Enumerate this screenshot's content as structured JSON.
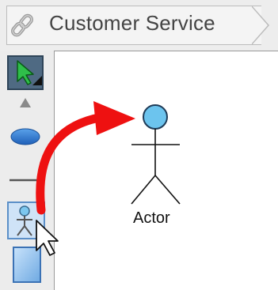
{
  "breadcrumb": {
    "icon": "link-icon",
    "label": "Customer Service"
  },
  "toolbar": {
    "tools": [
      {
        "name": "select-tool",
        "icon": "selection-arrow-icon",
        "selected": true
      },
      {
        "name": "collapse-tool",
        "icon": "triangle-up-icon"
      },
      {
        "name": "use-case-tool",
        "icon": "ellipse-icon"
      },
      {
        "name": "association-tool",
        "icon": "line-icon"
      },
      {
        "name": "actor-tool",
        "icon": "actor-icon",
        "hovered": true
      },
      {
        "name": "system-tool",
        "icon": "rectangle-icon"
      }
    ]
  },
  "canvas": {
    "actor": {
      "label": "Actor"
    }
  },
  "colors": {
    "actor_head": "#6cc4ee",
    "arrow": "#ee1111",
    "use_case": "#2a6fc7",
    "select_cursor": "#29b34a"
  }
}
